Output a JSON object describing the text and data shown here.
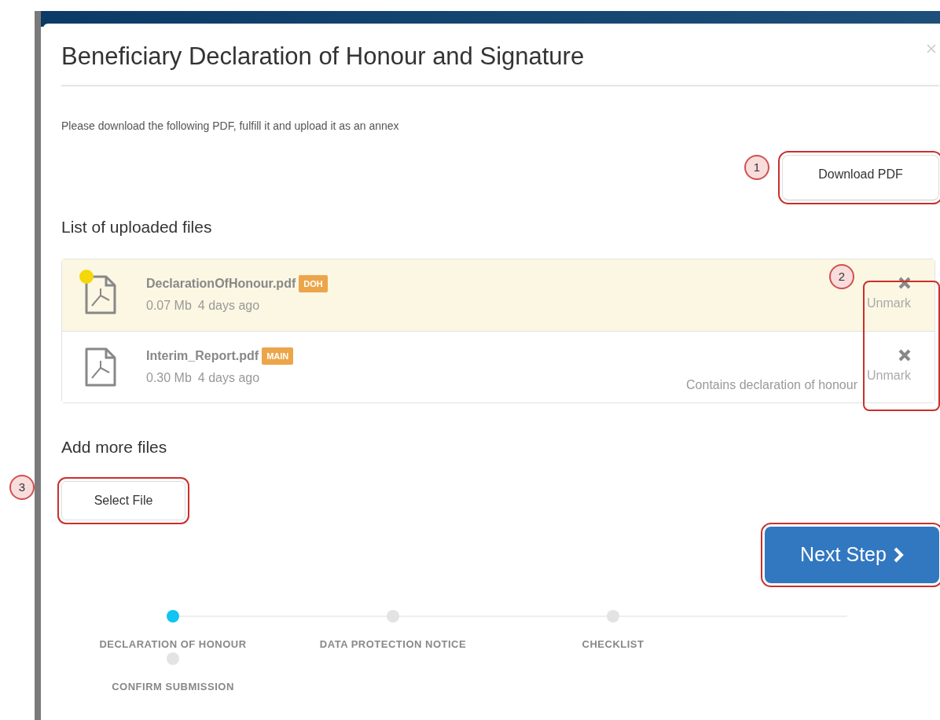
{
  "dialog": {
    "title": "Beneficiary Declaration of Honour and Signature",
    "instruction": "Please download the following PDF, fulfill it and upload it as an annex",
    "download_button": {
      "label": "Download PDF",
      "callout": "1",
      "highlighted": true
    },
    "uploaded_files": {
      "heading": "List of uploaded files",
      "actions_callout": "2",
      "actions_highlighted": true,
      "files": [
        {
          "name": "DeclarationOfHonour.pdf",
          "tag": "DOH",
          "size": "0.07 Mb",
          "age": "4 days ago",
          "marked": true,
          "action": "Unmark"
        },
        {
          "name": "Interim_Report.pdf",
          "tag": "MAIN",
          "size": "0.30 Mb",
          "age": "4 days ago",
          "note": "Contains declaration of honour",
          "marked": false,
          "action": "Unmark"
        }
      ]
    },
    "add_files": {
      "heading": "Add more files",
      "select_button": {
        "label": "Select File",
        "callout": "3",
        "highlighted": true
      }
    },
    "next_button": {
      "label": "Next Step",
      "highlighted": true
    },
    "steps": [
      {
        "label": "DECLARATION OF HONOUR",
        "selected": true
      },
      {
        "label": "DATA PROTECTION NOTICE",
        "selected": false
      },
      {
        "label": "CHECKLIST",
        "selected": false
      },
      {
        "label": "CONFIRM SUBMISSION",
        "selected": false
      }
    ]
  }
}
